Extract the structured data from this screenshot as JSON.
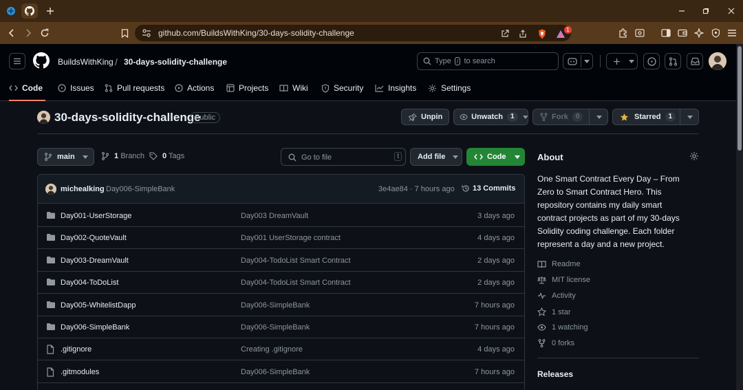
{
  "browser": {
    "url": "github.com/BuildsWithKing/30-days-solidity-challenge",
    "notification_count": "1"
  },
  "header": {
    "owner": "BuildsWithKing",
    "repo": "30-days-solidity-challenge",
    "search_prefix": "Type",
    "search_key": "/",
    "search_suffix": "to search"
  },
  "tabs": [
    {
      "label": "Code",
      "icon": "code-icon",
      "active": true
    },
    {
      "label": "Issues",
      "icon": "issue-icon"
    },
    {
      "label": "Pull requests",
      "icon": "pull-request-icon"
    },
    {
      "label": "Actions",
      "icon": "play-icon"
    },
    {
      "label": "Projects",
      "icon": "table-icon"
    },
    {
      "label": "Wiki",
      "icon": "book-icon"
    },
    {
      "label": "Security",
      "icon": "shield-icon"
    },
    {
      "label": "Insights",
      "icon": "graph-icon"
    },
    {
      "label": "Settings",
      "icon": "gear-icon"
    }
  ],
  "repo": {
    "title": "30-days-solidity-challenge",
    "visibility": "Public",
    "unpin": "Unpin",
    "unwatch": "Unwatch",
    "watch_count": "1",
    "fork": "Fork",
    "fork_count": "0",
    "starred": "Starred",
    "star_count": "1"
  },
  "toolbar": {
    "branch": "main",
    "branch_count": "1",
    "branch_label": "Branch",
    "tag_count": "0",
    "tag_label": "Tags",
    "goto_placeholder": "Go to file",
    "goto_key": "t",
    "add_file": "Add file",
    "code": "Code"
  },
  "commit": {
    "user": "michealking",
    "message": "Day006-SimpleBank",
    "hash_time": "3e4ae84 · 7 hours ago",
    "commits": "13 Commits"
  },
  "files": [
    {
      "type": "folder",
      "name": "Day001-UserStorage",
      "message": "Day003 DreamVault",
      "date": "3 days ago"
    },
    {
      "type": "folder",
      "name": "Day002-QuoteVault",
      "message": "Day001 UserStorage contract",
      "date": "4 days ago"
    },
    {
      "type": "folder",
      "name": "Day003-DreamVault",
      "message": "Day004-TodoList Smart Contract",
      "date": "2 days ago"
    },
    {
      "type": "folder",
      "name": "Day004-ToDoList",
      "message": "Day004-TodoList Smart Contract",
      "date": "2 days ago"
    },
    {
      "type": "folder",
      "name": "Day005-WhitelistDapp",
      "message": "Day006-SimpleBank",
      "date": "7 hours ago"
    },
    {
      "type": "folder",
      "name": "Day006-SimpleBank",
      "message": "Day006-SimpleBank",
      "date": "7 hours ago"
    },
    {
      "type": "file",
      "name": ".gitignore",
      "message": "Creating .gitignore",
      "date": "4 days ago"
    },
    {
      "type": "file",
      "name": ".gitmodules",
      "message": "Day006-SimpleBank",
      "date": "7 hours ago"
    }
  ],
  "about": {
    "heading": "About",
    "description": "One Smart Contract Every Day – From Zero to Smart Contract Hero. This repository contains my daily smart contract projects as part of my 30-days Solidity coding challenge. Each folder represent a day and a new project.",
    "links": [
      {
        "label": "Readme",
        "icon": "book-icon"
      },
      {
        "label": "MIT license",
        "icon": "law-icon"
      },
      {
        "label": "Activity",
        "icon": "pulse-icon"
      },
      {
        "label": "1 star",
        "icon": "star-icon"
      },
      {
        "label": "1 watching",
        "icon": "eye-icon"
      },
      {
        "label": "0 forks",
        "icon": "fork-icon"
      }
    ],
    "releases": "Releases"
  },
  "colors": {
    "accent": "#f78166",
    "code_button": "#238636",
    "star": "#e3b341",
    "browser_frame": "#57391b"
  }
}
